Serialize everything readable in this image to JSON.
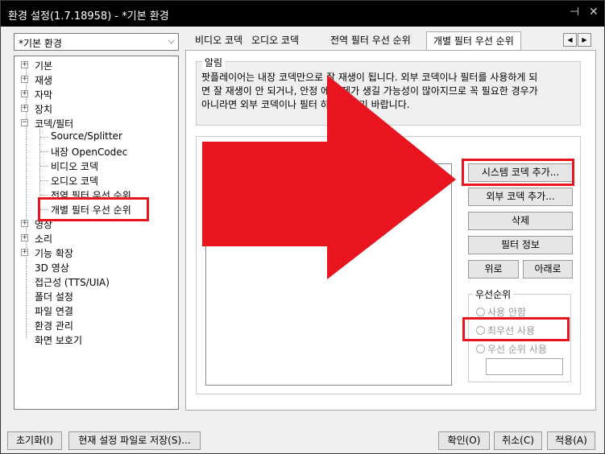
{
  "window": {
    "title": "환경 설정(1.7.18958) - *기본 환경"
  },
  "profile": {
    "selected": "*기본 환경"
  },
  "tree": {
    "top_items": [
      "기본",
      "재생",
      "자막",
      "장치",
      "코덱/필터"
    ],
    "codec_children": [
      "Source/Splitter",
      "내장 OpenCodec",
      "비디오 코덱",
      "오디오 코덱",
      "전역 필터 우선 순위",
      "개별 필터 우선 순위"
    ],
    "lower_items": [
      "영상",
      "소리",
      "기능 확장",
      "3D 영상",
      "접근성 (TTS/UIA)",
      "폴더 설정",
      "파일 연결",
      "환경 관리",
      "화면 보호기"
    ]
  },
  "tabs": [
    "비디오 코덱",
    "오디오 코덱",
    "전역 필터 우선 순위",
    "개별 필터 우선 순위"
  ],
  "notice": {
    "label": "알림",
    "line1": "팟플레이어는 내장 코덱만으로 잘 재생이 됩니다. 외부 코덱이나 필터를 사용하게 되",
    "line2": "면 잘 재생이 안 되거나, 안정  에 문제가 생길 가능성이 많아지므로 꼭 필요한 경우가",
    "line3": "아니라면 외부 코덱이나 필터    하지 마시기 바랍니다."
  },
  "buttons": {
    "add_system_codec": "시스템 코덱 추가...",
    "add_external_codec": "외부 코덱 추가...",
    "delete": "삭제",
    "filter_info": "필터 정보",
    "up": "위로",
    "down": "아래로"
  },
  "priority": {
    "label": "우선순위",
    "options": [
      "사용 안함",
      "최우선 사용",
      "우선 순위 사용"
    ]
  },
  "footer": {
    "reset": "초기화(I)",
    "save_file": "현재 설정 파일로 저장(S)...",
    "ok": "확인(O)",
    "cancel": "취소(C)",
    "apply": "적용(A)"
  },
  "colors": {
    "highlight": "#e8151e",
    "titlebar": "#000000"
  }
}
